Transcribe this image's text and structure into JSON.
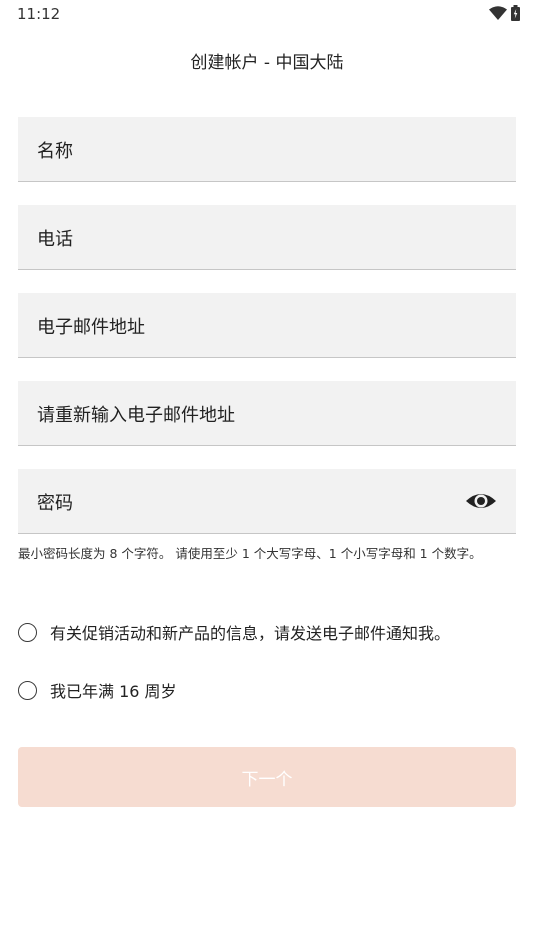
{
  "status_bar": {
    "time": "11:12",
    "icons": [
      "wifi-icon",
      "battery-icon"
    ]
  },
  "header": {
    "title": "创建帐户 - 中国大陆"
  },
  "form": {
    "fields": [
      {
        "label": "名称"
      },
      {
        "label": "电话"
      },
      {
        "label": "电子邮件地址"
      },
      {
        "label": "请重新输入电子邮件地址"
      },
      {
        "label": "密码"
      }
    ],
    "password_hint": "最小密码长度为 8 个字符。 请使用至少 1 个大写字母、1 个小写字母和 1 个数字。",
    "checkboxes": [
      {
        "label": "有关促销活动和新产品的信息，请发送电子邮件通知我。",
        "checked": false
      },
      {
        "label": "我已年满 16 周岁",
        "checked": false
      }
    ],
    "next_button": "下一个"
  },
  "colors": {
    "field_background": "#f2f2f2",
    "button_disabled": "#f6dcd1"
  }
}
